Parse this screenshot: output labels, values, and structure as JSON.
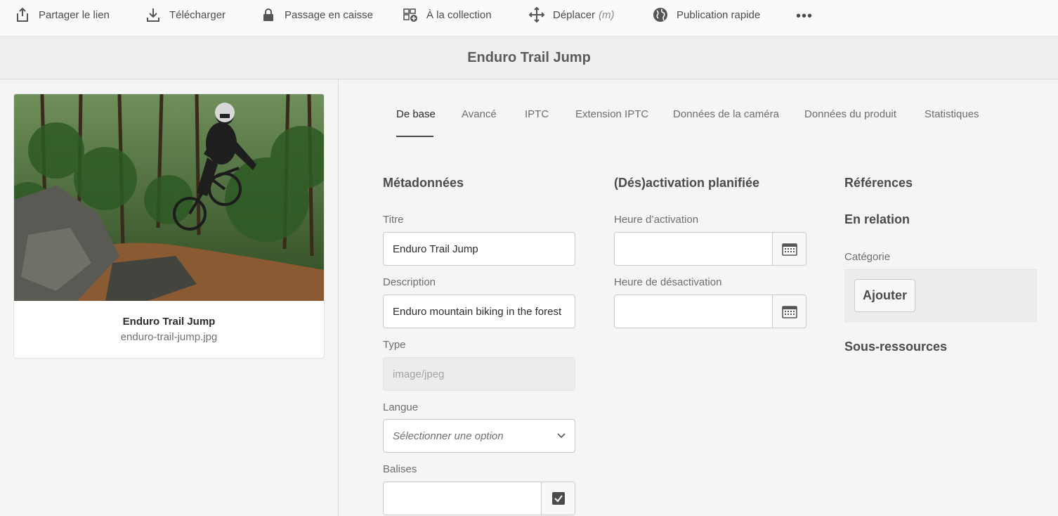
{
  "toolbar": {
    "items": [
      {
        "label": "Partager le lien",
        "icon": "share-icon"
      },
      {
        "label": "Télécharger",
        "icon": "download-icon"
      },
      {
        "label": "Passage en caisse",
        "icon": "lock-icon"
      },
      {
        "label": "À la collection",
        "icon": "add-to-collection-icon"
      },
      {
        "label": "Déplacer",
        "icon": "move-icon",
        "shortcut": "(m)"
      },
      {
        "label": "Publication rapide",
        "icon": "globe-icon"
      }
    ],
    "more": "•••"
  },
  "header": {
    "title": "Enduro Trail Jump"
  },
  "asset_card": {
    "title": "Enduro Trail Jump",
    "filename": "enduro-trail-jump.jpg"
  },
  "tabs": [
    {
      "label": "De base",
      "active": true
    },
    {
      "label": "Avancé"
    },
    {
      "label": "IPTC"
    },
    {
      "label": "Extension IPTC"
    },
    {
      "label": "Données de la caméra"
    },
    {
      "label": "Données du produit"
    },
    {
      "label": "Statistiques"
    }
  ],
  "metadata": {
    "heading": "Métadonnées",
    "title_label": "Titre",
    "title_value": "Enduro Trail Jump",
    "description_label": "Description",
    "description_value": "Enduro mountain biking in the forest",
    "type_label": "Type",
    "type_value": "image/jpeg",
    "language_label": "Langue",
    "language_placeholder": "Sélectionner une option",
    "tags_label": "Balises"
  },
  "scheduling": {
    "heading": "(Dés)activation planifiée",
    "on_time_label": "Heure d’activation",
    "off_time_label": "Heure de désactivation"
  },
  "references": {
    "heading": "Références",
    "related_heading": "En relation",
    "category_label": "Catégorie",
    "add_button": "Ajouter",
    "subassets_heading": "Sous-ressources"
  },
  "colors": {
    "text": "#4b4b4b",
    "toolbar_bg": "#fafafa",
    "page_bg": "#f5f5f5",
    "field_border": "#cacaca"
  }
}
